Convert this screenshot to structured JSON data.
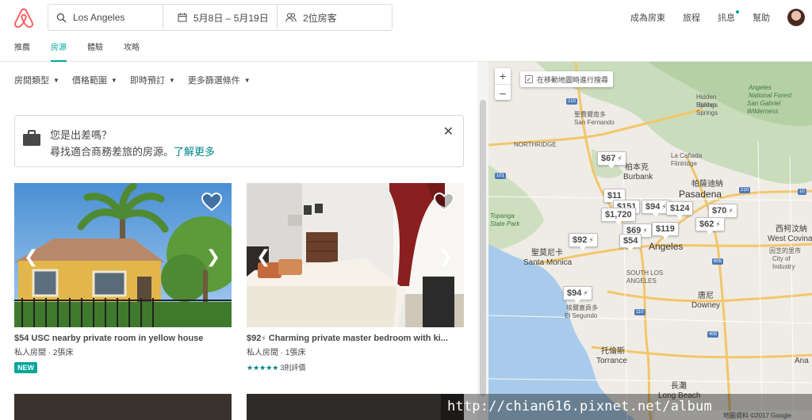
{
  "header": {
    "search": {
      "location": "Los Angeles",
      "dates": "5月8日 – 5月19日",
      "guests": "2位房客"
    },
    "nav": [
      "成為房東",
      "旅程",
      "訊息",
      "幫助"
    ]
  },
  "tabs": [
    {
      "label": "推薦",
      "active": false
    },
    {
      "label": "房源",
      "active": true
    },
    {
      "label": "體驗",
      "active": false
    },
    {
      "label": "攻略",
      "active": false
    }
  ],
  "filters": [
    "房間類型",
    "價格範圍",
    "即時預訂",
    "更多篩選條件"
  ],
  "banner": {
    "title": "您是出差嗎？",
    "subtitle": "尋找適合商務差旅的房源。",
    "link": "了解更多"
  },
  "listings": [
    {
      "price": "$54",
      "title": "USC nearby private room in yellow house",
      "subtitle": "私人房間 · 2張床",
      "badge": "NEW"
    },
    {
      "price": "$92",
      "title": "Charming private master bedroom with ki...",
      "subtitle": "私人房間 · 1張床",
      "stars": "★★★★★",
      "reviews": "3則評價"
    }
  ],
  "map": {
    "search_as_move": "在移動地圖時進行搜尋",
    "pins": [
      "$67",
      "$11",
      "$151",
      "$94",
      "$124",
      "$70",
      "$1,720",
      "$62",
      "$69",
      "$119",
      "$92",
      "$54",
      "$94"
    ],
    "labels": {
      "angeles_nf": "Angeles\nNational Forest",
      "san_gabriel": "San Gabriel\nWilderness",
      "hidden_springs": "Hidden\nSprings",
      "san_fernando": "聖費爾南多\nSan Fernando",
      "northridge": "NORTHRIDGE",
      "la_canada": "La Cañada\nFlintridge",
      "burbank_zh": "柏本克",
      "burbank": "Burbank",
      "pasadena_zh": "帕薩迪納",
      "pasadena": "Pasadena",
      "topanga": "Topanga\nState Park",
      "santa_monica_zh": "聖莫尼卡",
      "santa_monica": "Santa Monica",
      "la": "Angeles",
      "west_covina_zh": "西柯汶納",
      "west_covina": "West Covina",
      "industry_zh": "因芝的里市",
      "industry": "City of\nIndustry",
      "downey_zh": "唐尼",
      "downey": "Downey",
      "el_segundo_zh": "埃爾塞貢多",
      "el_segundo": "El Segundo",
      "torrance_zh": "托倫斯",
      "torrance": "Torrance",
      "long_beach_zh": "長灘",
      "long_beach": "Long Beach",
      "south_la": "SOUTH LOS\nANGELES",
      "ana": "Ana",
      "copyright": "地圖資料 ©2017 Google"
    }
  },
  "watermark": "http://chian616.pixnet.net/album",
  "colors": {
    "brand": "#ff5a5f",
    "accent": "#00a699",
    "link": "#008489"
  }
}
